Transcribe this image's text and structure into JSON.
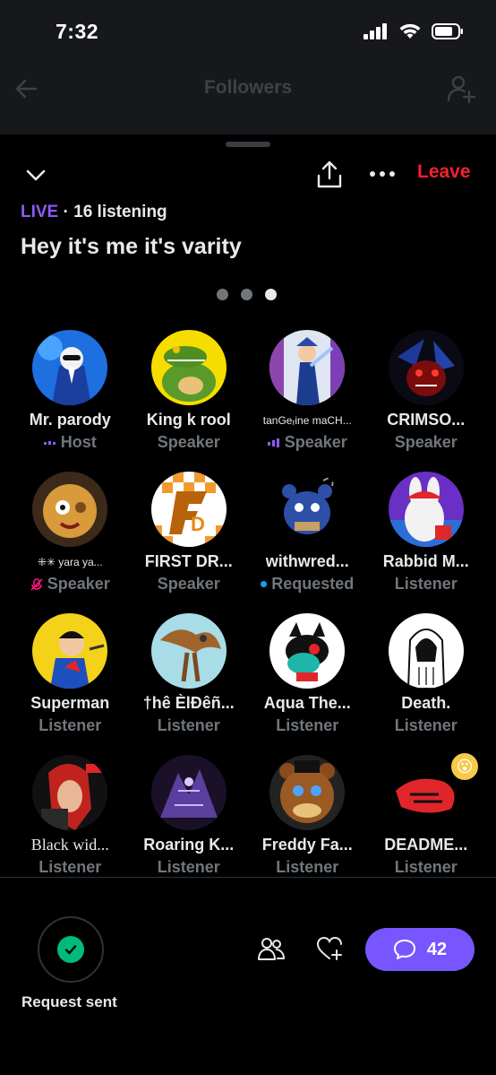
{
  "status_bar": {
    "time": "7:32"
  },
  "header": {
    "title": "Followers"
  },
  "space": {
    "leave_label": "Leave",
    "live_label": "LIVE",
    "listening_label": "· 16 listening",
    "title": "Hey it's me it's varity",
    "page_count": 3,
    "active_page": 3
  },
  "participants": [
    {
      "name": "Mr. parody",
      "role": "Host",
      "indicator": "speaking",
      "avatar": "blue-suit"
    },
    {
      "name": "King k rool",
      "role": "Speaker",
      "avatar": "crocodile"
    },
    {
      "name": "tanGeᵣine maCH...",
      "role": "Speaker",
      "indicator": "speaking",
      "avatar": "mecha"
    },
    {
      "name": "CRIMSO...",
      "role": "Speaker",
      "avatar": "dark-red"
    },
    {
      "name": "⁜✳︎ yara ya...",
      "role": "Speaker",
      "indicator": "muted",
      "avatar": "doll"
    },
    {
      "name": "FIRST DR...",
      "role": "Speaker",
      "avatar": "fd-logo"
    },
    {
      "name": "withwred...",
      "role": "Requested",
      "indicator": "requested",
      "avatar": "blue-bear"
    },
    {
      "name": "Rabbid M...",
      "role": "Listener",
      "avatar": "rabbid"
    },
    {
      "name": "Superman",
      "role": "Listener",
      "avatar": "superman"
    },
    {
      "name": "†hê ÈlĐêñ...",
      "role": "Listener",
      "avatar": "dragon"
    },
    {
      "name": "Aqua The...",
      "role": "Listener",
      "avatar": "aqua"
    },
    {
      "name": "Death.",
      "role": "Listener",
      "avatar": "death"
    },
    {
      "name": "Black wid...",
      "role": "Listener",
      "avatar": "black-widow"
    },
    {
      "name": "Roaring K...",
      "role": "Listener",
      "avatar": "roaring"
    },
    {
      "name": "Freddy Fa...",
      "role": "Listener",
      "avatar": "freddy"
    },
    {
      "name": "DEADME...",
      "role": "Listener",
      "avatar": "deadmeat",
      "reaction": "😮"
    }
  ],
  "footer": {
    "request_label": "Request sent",
    "comments_count": "42"
  },
  "colors": {
    "accent_purple": "#7856ff",
    "live_purple": "#8c5cf5",
    "leave_red": "#f4212e",
    "success_green": "#00ba7c",
    "muted_gray": "#71767b"
  }
}
